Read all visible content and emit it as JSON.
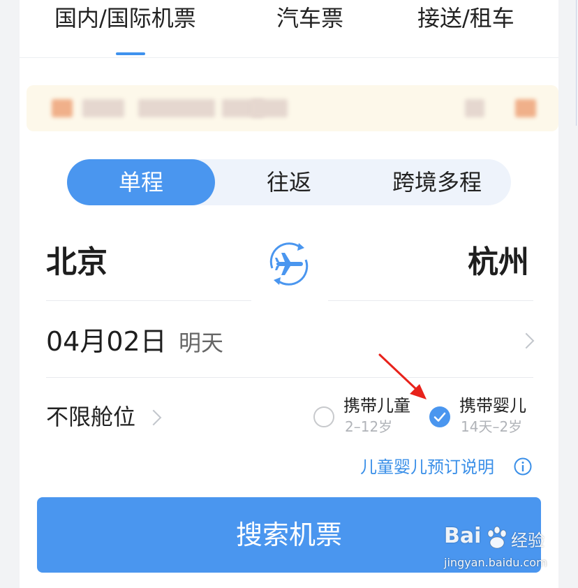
{
  "tabs": {
    "flight": "国内/国际机票",
    "bus": "汽车票",
    "transfer": "接送/租车"
  },
  "trip_type": {
    "one_way": "单程",
    "round_trip": "往返",
    "multi_city": "跨境多程",
    "selected": "单程"
  },
  "route": {
    "from": "北京",
    "to": "杭州",
    "swap_icon": "plane-swap-icon"
  },
  "date": {
    "value": "04月02日",
    "relative": "明天"
  },
  "cabin": {
    "label": "不限舱位"
  },
  "passengers": {
    "child": {
      "label": "携带儿童",
      "age_range": "2–12岁",
      "checked": false
    },
    "infant": {
      "label": "携带婴儿",
      "age_range": "14天–2岁",
      "checked": true
    }
  },
  "booking_notice": {
    "label": "儿童婴儿预订说明",
    "icon": "info-icon"
  },
  "search": {
    "label": "搜索机票"
  },
  "watermark": {
    "brand": "Bai",
    "brand_suffix": "经验",
    "url": "jingyan.baidu.com"
  },
  "colors": {
    "accent": "#4a96ef",
    "link": "#3a8fe8",
    "notice_bg": "#fdf8ea",
    "annotation": "#e8221b"
  }
}
